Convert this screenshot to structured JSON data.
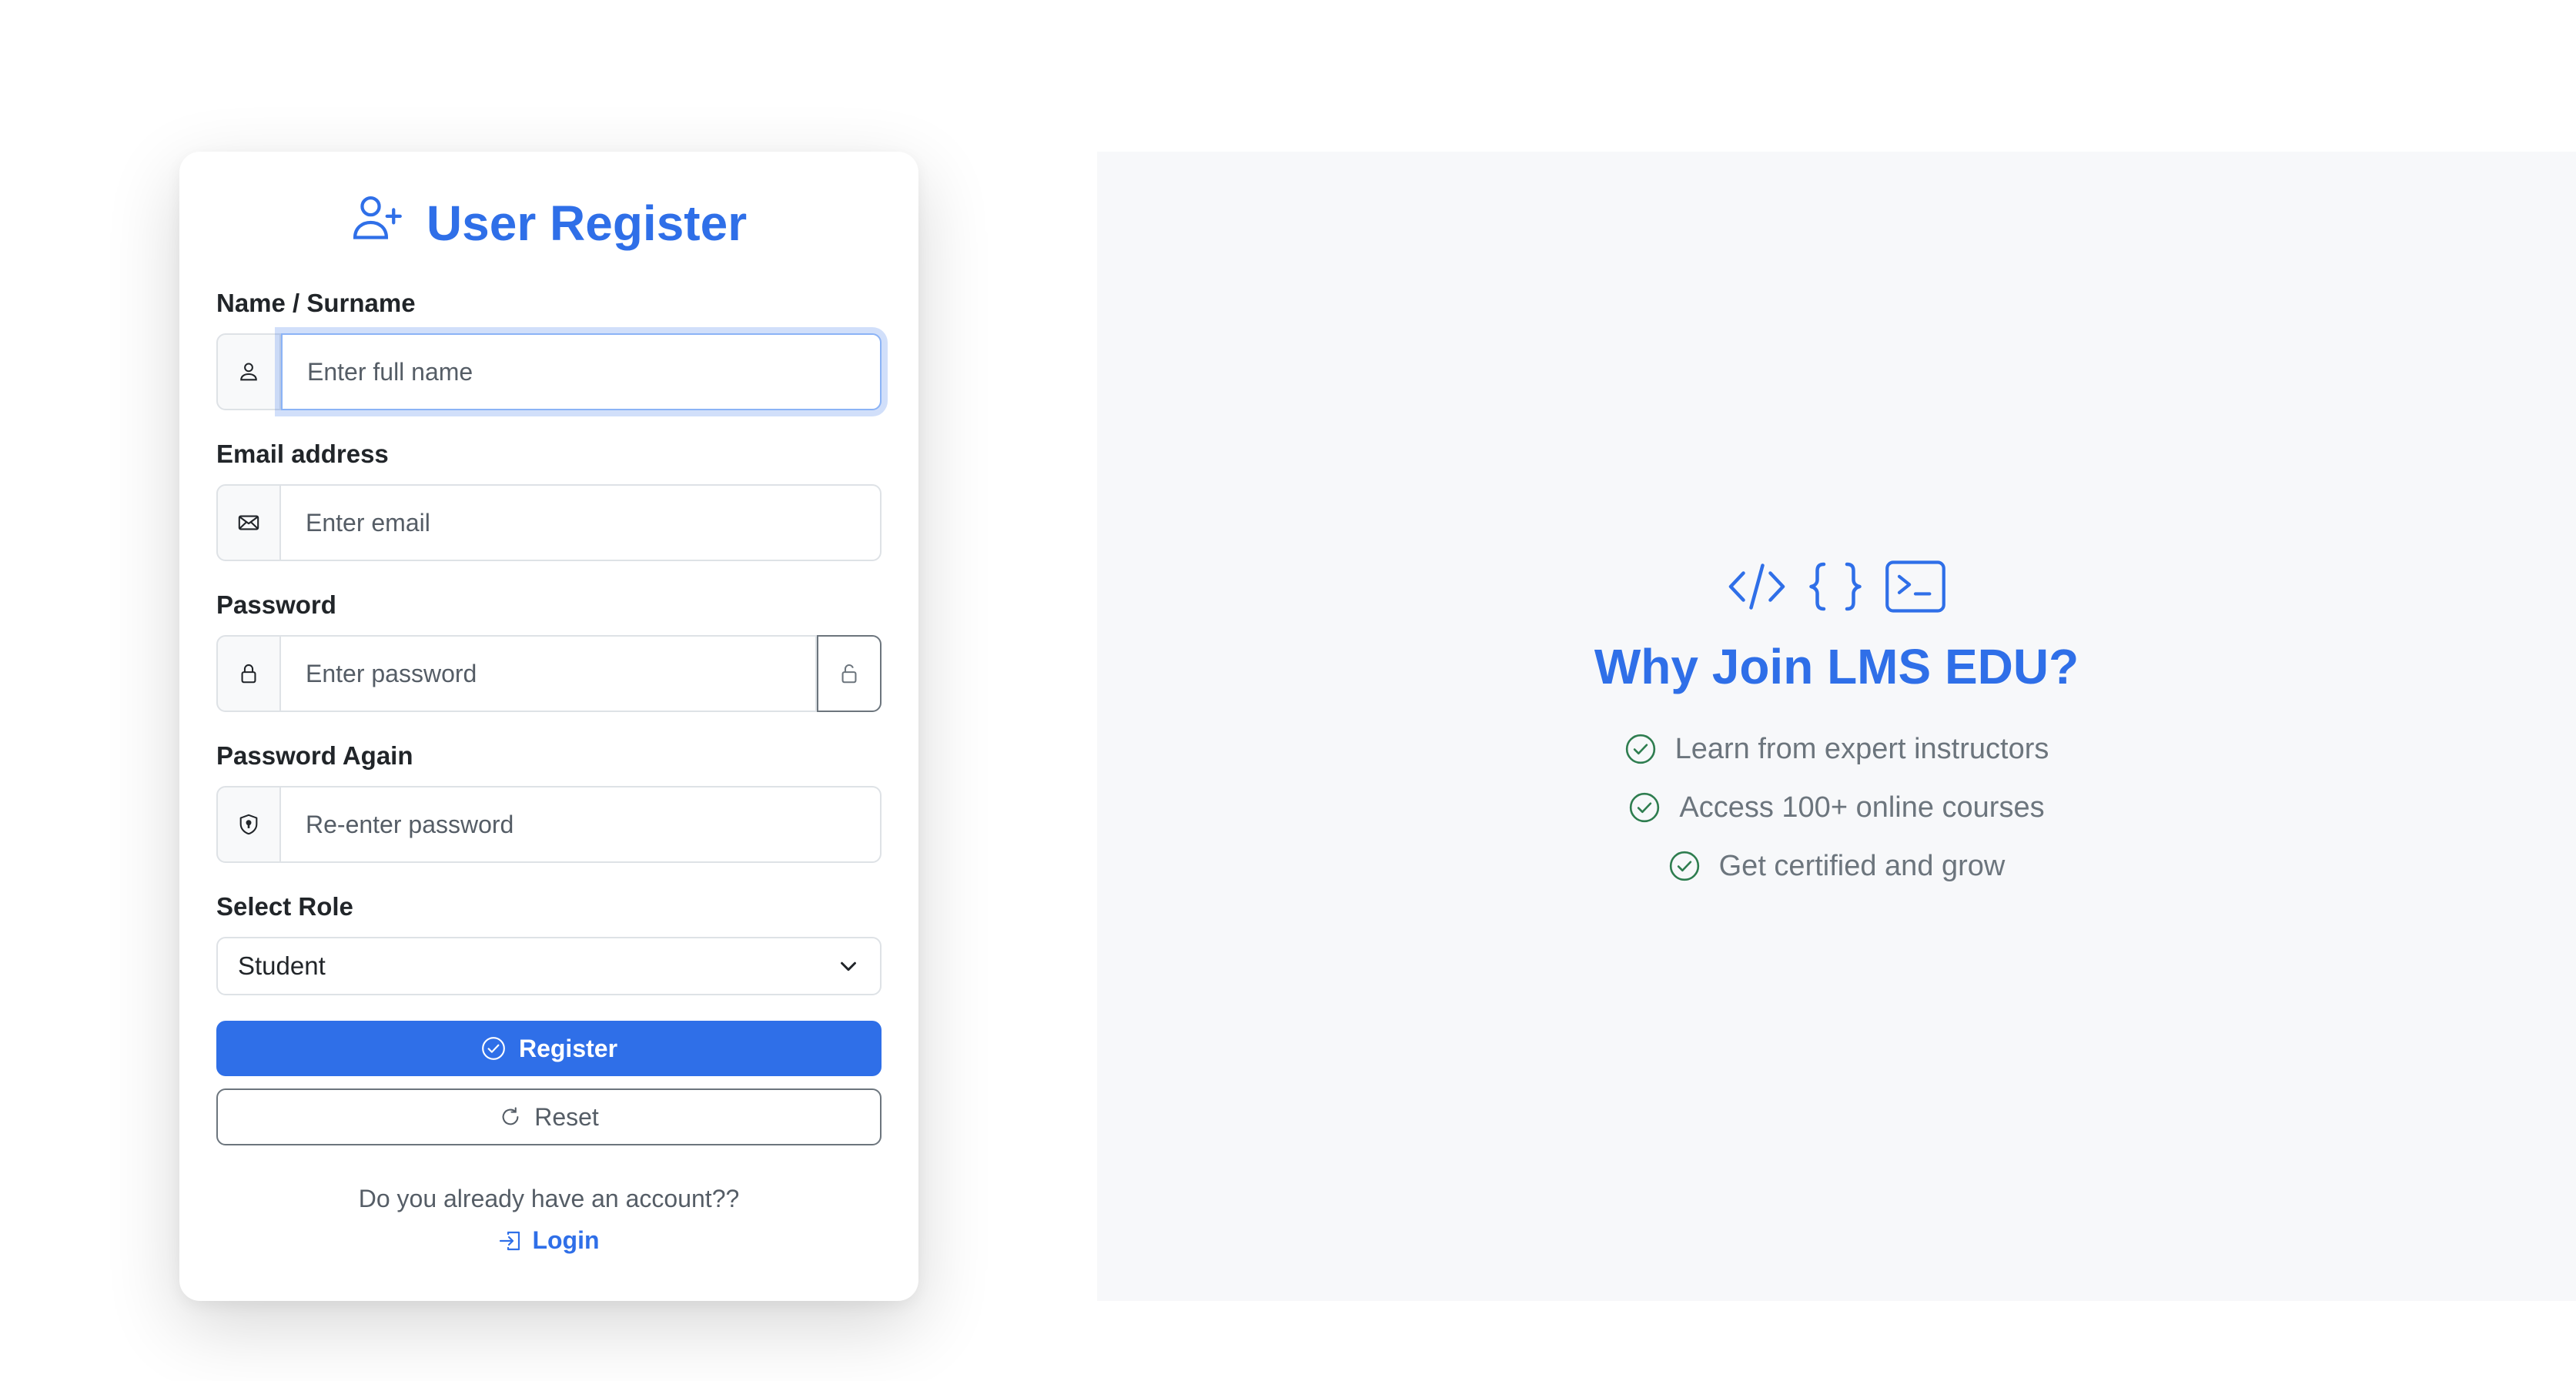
{
  "register_form": {
    "title": "User Register",
    "name_label": "Name / Surname",
    "name_placeholder": "Enter full name",
    "email_label": "Email address",
    "email_placeholder": "Enter email",
    "password_label": "Password",
    "password_placeholder": "Enter password",
    "password_again_label": "Password Again",
    "password_again_placeholder": "Re-enter password",
    "role_label": "Select Role",
    "role_selected": "Student",
    "register_button": "Register",
    "reset_button": "Reset",
    "account_prompt": "Do you already have an account??",
    "login_link": "Login"
  },
  "promo": {
    "title": "Why Join LMS EDU?",
    "features": [
      "Learn from expert instructors",
      "Access 100+ online courses",
      "Get certified and grow"
    ]
  },
  "icons": {
    "title": "person-plus-icon",
    "name": "person-icon",
    "email": "envelope-icon",
    "password": "lock-icon",
    "password_toggle": "unlock-icon",
    "password_again": "shield-lock-icon",
    "role": "chevron-down-icon",
    "register": "check-circle-icon",
    "reset": "refresh-icon",
    "login": "box-arrow-in-right-icon",
    "promo": [
      "code-slash-icon",
      "braces-icon",
      "terminal-icon"
    ],
    "feature": "check-circle-icon"
  },
  "colors": {
    "primary": "#2f6fe8",
    "panel_background": "#f7f8fa",
    "feature_check": "#2e7d4f",
    "muted_text": "#6c757d"
  }
}
